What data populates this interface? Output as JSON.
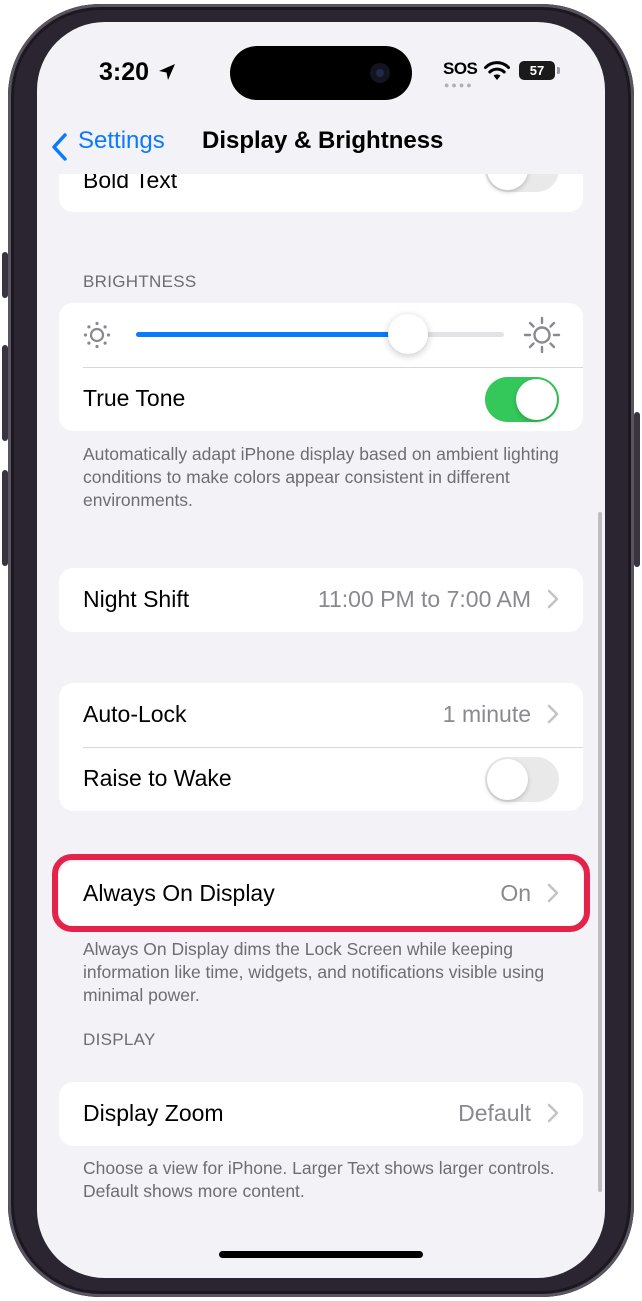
{
  "status_bar": {
    "time": "3:20",
    "sos": "SOS",
    "battery": "57"
  },
  "nav": {
    "back_label": "Settings",
    "title": "Display & Brightness"
  },
  "bold_text": {
    "label": "Bold Text",
    "on": false
  },
  "brightness": {
    "header": "BRIGHTNESS",
    "level": 0.74,
    "true_tone": {
      "label": "True Tone",
      "on": true
    },
    "footnote": "Automatically adapt iPhone display based on ambient lighting conditions to make colors appear consistent in different environments."
  },
  "night_shift": {
    "label": "Night Shift",
    "value": "11:00 PM to 7:00 AM"
  },
  "auto_lock": {
    "label": "Auto-Lock",
    "value": "1 minute"
  },
  "raise_to_wake": {
    "label": "Raise to Wake",
    "on": false
  },
  "always_on": {
    "label": "Always On Display",
    "value": "On",
    "footnote": "Always On Display dims the Lock Screen while keeping information like time, widgets, and notifications visible using minimal power."
  },
  "display": {
    "header": "DISPLAY",
    "zoom_label": "Display Zoom",
    "zoom_value": "Default",
    "footnote": "Choose a view for iPhone. Larger Text shows larger controls. Default shows more content."
  },
  "colors": {
    "accent": "#0a7aff",
    "toggle_on": "#34c759",
    "highlight": "#e5224a"
  },
  "icons": [
    "location-arrow-icon",
    "wifi-icon",
    "battery-icon",
    "back-chevron-icon",
    "sun-small-icon",
    "sun-large-icon",
    "chevron-right-icon"
  ]
}
